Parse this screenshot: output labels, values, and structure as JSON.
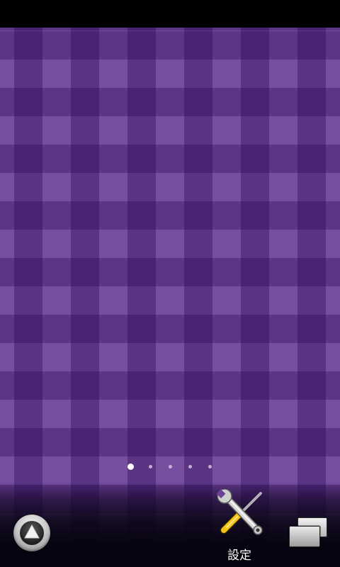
{
  "home_screen": {
    "page_indicator": {
      "page_count": 5,
      "active_page": 1
    },
    "dock": {
      "app_drawer_button": {
        "icon": "up-arrow-icon"
      },
      "shortcuts": [
        {
          "label": "設定",
          "icon": "wrench-screwdriver-icon"
        }
      ],
      "recent_apps_button": {
        "icon": "stacked-windows-icon"
      }
    }
  }
}
